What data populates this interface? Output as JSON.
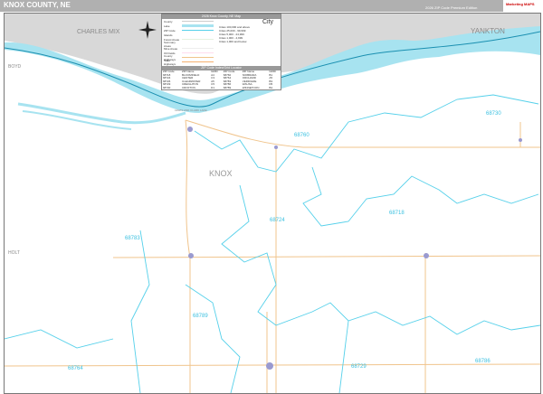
{
  "header": {
    "title": "KNOX COUNTY, NE",
    "edition": "2026 ZIP Code Premium Edition",
    "logo_text": "Marketing MAPS"
  },
  "legend": {
    "title": "2026 Knox County, NE Map",
    "rows": [
      "County",
      "Lake",
      "ZIP Code",
      "Islands",
      "Forest Areas",
      "Summary Areas",
      "Mine Areas",
      "Oil Fields",
      "County Highways",
      "State Highways",
      "US Highways",
      "Interstate Highways",
      "Toll Roads"
    ],
    "city_label": "City",
    "pop_rows": [
      "Cities 100,000 and above",
      "Cities 25,000 - 99,999",
      "Cities 5,000 - 24,999",
      "Cities 1,000 - 4,999",
      "Cities 1,000 and below"
    ]
  },
  "zip_table": {
    "title": "ZIP Code Index/Grid Locator",
    "headers": [
      "ZIP Code",
      "ZIP Name",
      "GRID",
      "ZIP Code",
      "ZIP Name",
      "GRID"
    ],
    "rows": [
      [
        "68718",
        "BLOOMFIELD",
        "A4",
        "68760",
        "NIOBRARA",
        "B1"
      ],
      [
        "68724",
        "CENTER",
        "C3",
        "68764",
        "ORCHARD",
        "A5"
      ],
      [
        "68726",
        "CLEARWATER",
        "A5",
        "68783",
        "VERDIGRE",
        "B3"
      ],
      [
        "68729",
        "CREIGHTON",
        "C5",
        "68786",
        "WAUSA",
        "D5"
      ],
      [
        "68730",
        "CROFTON",
        "D1",
        "68789",
        "WINNETOON",
        "B4"
      ]
    ]
  },
  "map_labels": {
    "state_areas": [
      "CHARLES MIX",
      "YANKTON",
      "BOYD",
      "HOLT"
    ],
    "county": "KNOX",
    "lake": "LEWIS AND CLARK LAKE",
    "zips": [
      "68760",
      "68730",
      "68718",
      "68724",
      "68783",
      "68789",
      "68729",
      "68786",
      "68764"
    ]
  },
  "colors": {
    "header": "#b0b0b0",
    "water": "#a7e3f0",
    "zip_boundary": "#55d0ea",
    "road": "#f0c48c",
    "outside": "#d8d8d8"
  }
}
